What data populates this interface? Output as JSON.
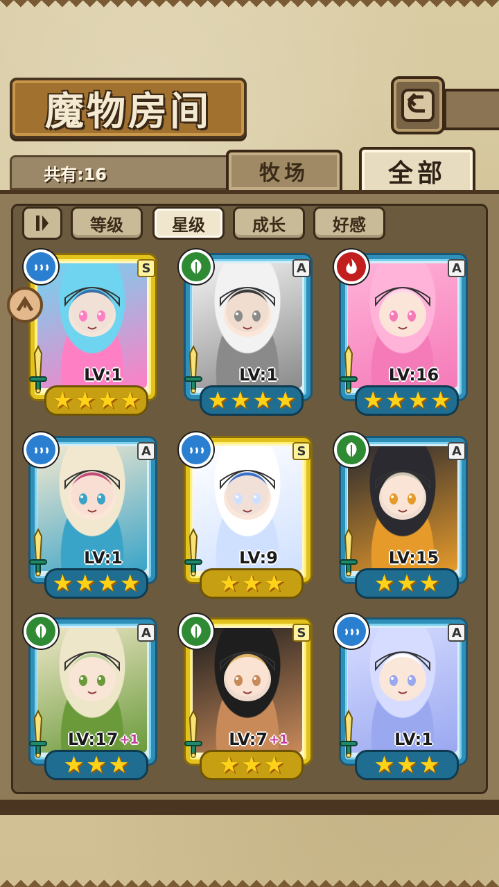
{
  "header": {
    "title": "魔物房间",
    "back_icon": "return-arrow-icon"
  },
  "count": {
    "label": "共有:16"
  },
  "tabs": [
    {
      "label": "牧场",
      "active": false
    },
    {
      "label": "全部",
      "active": true
    }
  ],
  "sort": {
    "toggle_icon": "pause-sort-icon",
    "buttons": [
      {
        "label": "等级",
        "active": false
      },
      {
        "label": "星级",
        "active": true
      },
      {
        "label": "成长",
        "active": false
      },
      {
        "label": "好感",
        "active": false
      }
    ]
  },
  "colors": {
    "blue_frame": "#2e8fb8",
    "gold_frame": "#e3c21e",
    "water": "#2b7fd0",
    "leaf": "#2f8a34",
    "fire": "#c21e1e"
  },
  "monsters": [
    {
      "element": "water",
      "rank": "S",
      "level": "LV:1",
      "plus": "",
      "stars": 4,
      "frame": "gold",
      "portrait": "blue-hair-float-ring"
    },
    {
      "element": "leaf",
      "rank": "A",
      "level": "LV:1",
      "plus": "",
      "stars": 4,
      "frame": "blue",
      "portrait": "white-hair-grey-skin"
    },
    {
      "element": "fire",
      "rank": "A",
      "level": "LV:16",
      "plus": "",
      "stars": 4,
      "frame": "blue",
      "portrait": "pink-slime-girl"
    },
    {
      "element": "water",
      "rank": "A",
      "level": "LV:1",
      "plus": "",
      "stars": 4,
      "frame": "blue",
      "portrait": "feather-headdress"
    },
    {
      "element": "water",
      "rank": "S",
      "level": "LV:9",
      "plus": "",
      "stars": 3,
      "frame": "gold",
      "portrait": "white-hair-sailor"
    },
    {
      "element": "leaf",
      "rank": "A",
      "level": "LV:15",
      "plus": "",
      "stars": 3,
      "frame": "blue",
      "portrait": "witch-black-hair"
    },
    {
      "element": "leaf",
      "rank": "A",
      "level": "LV:17",
      "plus": "+1",
      "stars": 3,
      "frame": "blue",
      "portrait": "fairy-green-leaf"
    },
    {
      "element": "leaf",
      "rank": "S",
      "level": "LV:7",
      "plus": "+1",
      "stars": 3,
      "frame": "gold",
      "portrait": "black-hair-tan-girl"
    },
    {
      "element": "water",
      "rank": "A",
      "level": "LV:1",
      "plus": "",
      "stars": 3,
      "frame": "blue",
      "portrait": "crystal-ice-girl"
    }
  ]
}
